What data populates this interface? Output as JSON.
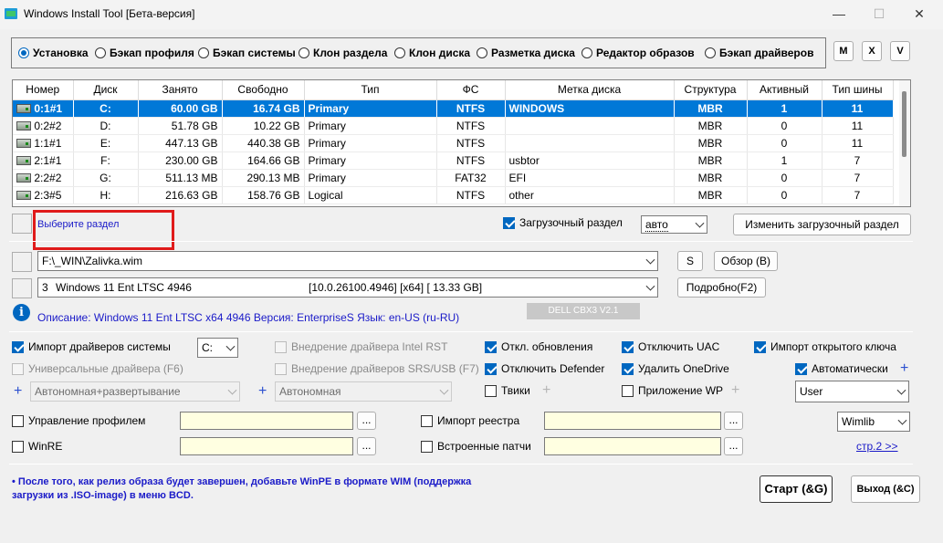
{
  "window": {
    "title": "Windows Install Tool [Бета-версия]",
    "min": "—",
    "max": "☐",
    "close": "✕"
  },
  "modes": [
    {
      "label": "Установка",
      "selected": true
    },
    {
      "label": "Бэкап профиля",
      "selected": false
    },
    {
      "label": "Бэкап системы",
      "selected": false
    },
    {
      "label": "Клон раздела",
      "selected": false
    },
    {
      "label": "Клон диска",
      "selected": false
    },
    {
      "label": "Разметка диска",
      "selected": false
    },
    {
      "label": "Редактор образов",
      "selected": false
    },
    {
      "label": "Бэкап драйверов",
      "selected": false
    }
  ],
  "corner_buttons": [
    "M",
    "X",
    "V"
  ],
  "table": {
    "headers": [
      "Номер",
      "Диск",
      "Занято",
      "Свободно",
      "Тип",
      "ФС",
      "Метка диска",
      "Структура",
      "Активный",
      "Тип шины"
    ],
    "rows": [
      [
        "0:1#1",
        "C:",
        "60.00 GB",
        "16.74 GB",
        "Primary",
        "NTFS",
        "WINDOWS",
        "MBR",
        "1",
        "11"
      ],
      [
        "0:2#2",
        "D:",
        "51.78 GB",
        "10.22 GB",
        "Primary",
        "NTFS",
        "",
        "MBR",
        "0",
        "11"
      ],
      [
        "1:1#1",
        "E:",
        "447.13 GB",
        "440.38 GB",
        "Primary",
        "NTFS",
        "",
        "MBR",
        "0",
        "11"
      ],
      [
        "2:1#1",
        "F:",
        "230.00 GB",
        "164.66 GB",
        "Primary",
        "NTFS",
        "usbtor",
        "MBR",
        "1",
        "7"
      ],
      [
        "2:2#2",
        "G:",
        "511.13 MB",
        "290.13 MB",
        "Primary",
        "FAT32",
        "EFI",
        "MBR",
        "0",
        "7"
      ],
      [
        "2:3#5",
        "H:",
        "216.63 GB",
        "158.76 GB",
        "Logical",
        "NTFS",
        "other",
        "MBR",
        "0",
        "7"
      ]
    ]
  },
  "partition": {
    "select_link": "Выберите раздел",
    "boot_label": "Загрузочный раздел",
    "boot_value": "авто",
    "change_boot_button": "Изменить загрузочный раздел"
  },
  "image": {
    "path": "F:\\_WIN\\Zalivka.wim",
    "s_button": "S",
    "browse_button": "Обзор (B)",
    "edition_index": "3",
    "edition_name": "Windows 11 Ent LTSC 4946",
    "edition_meta": "[10.0.26100.4946] [x64] [ 13.33 GB]",
    "details_button": "Подробно(F2)",
    "description": "Описание: Windows 11 Ent LTSC x64 4946 Версия: EnterpriseS Язык: en-US (ru-RU)",
    "badge": "DELL CBX3 V2.1"
  },
  "options": {
    "import_drivers": "Импорт драйверов системы",
    "import_drivers_drive": "C:",
    "universal_drivers": "Универсальные драйвера (F6)",
    "intel_rst": "Внедрение драйвера Intel RST",
    "srs_usb": "Внедрение драйверов SRS/USB (F7)",
    "disable_updates": "Откл. обновления",
    "disable_defender": "Отключить Defender",
    "tweaks": "Твики",
    "disable_uac": "Отключить UAC",
    "remove_onedrive": "Удалить OneDrive",
    "wp_app": "Приложение WP",
    "import_key": "Импорт открытого ключа",
    "auto": "Автоматически",
    "user_value": "User",
    "mode_left": "Автономная+развертывание",
    "mode_mid": "Автономная",
    "profile_mgmt": "Управление профилем",
    "winre": "WinRE",
    "import_registry": "Импорт реестра",
    "builtin_patches": "Встроенные патчи",
    "dots": "...",
    "wimlib": "Wimlib",
    "page2": "стр.2 >>"
  },
  "footer": {
    "note": "• После того, как релиз образа будет завершен, добавьте WinPE в формате WIM (поддержка загрузки из .ISO-image) в меню BCD.",
    "start_button": "Старт (&G)",
    "exit_button": "Выход (&C)"
  }
}
